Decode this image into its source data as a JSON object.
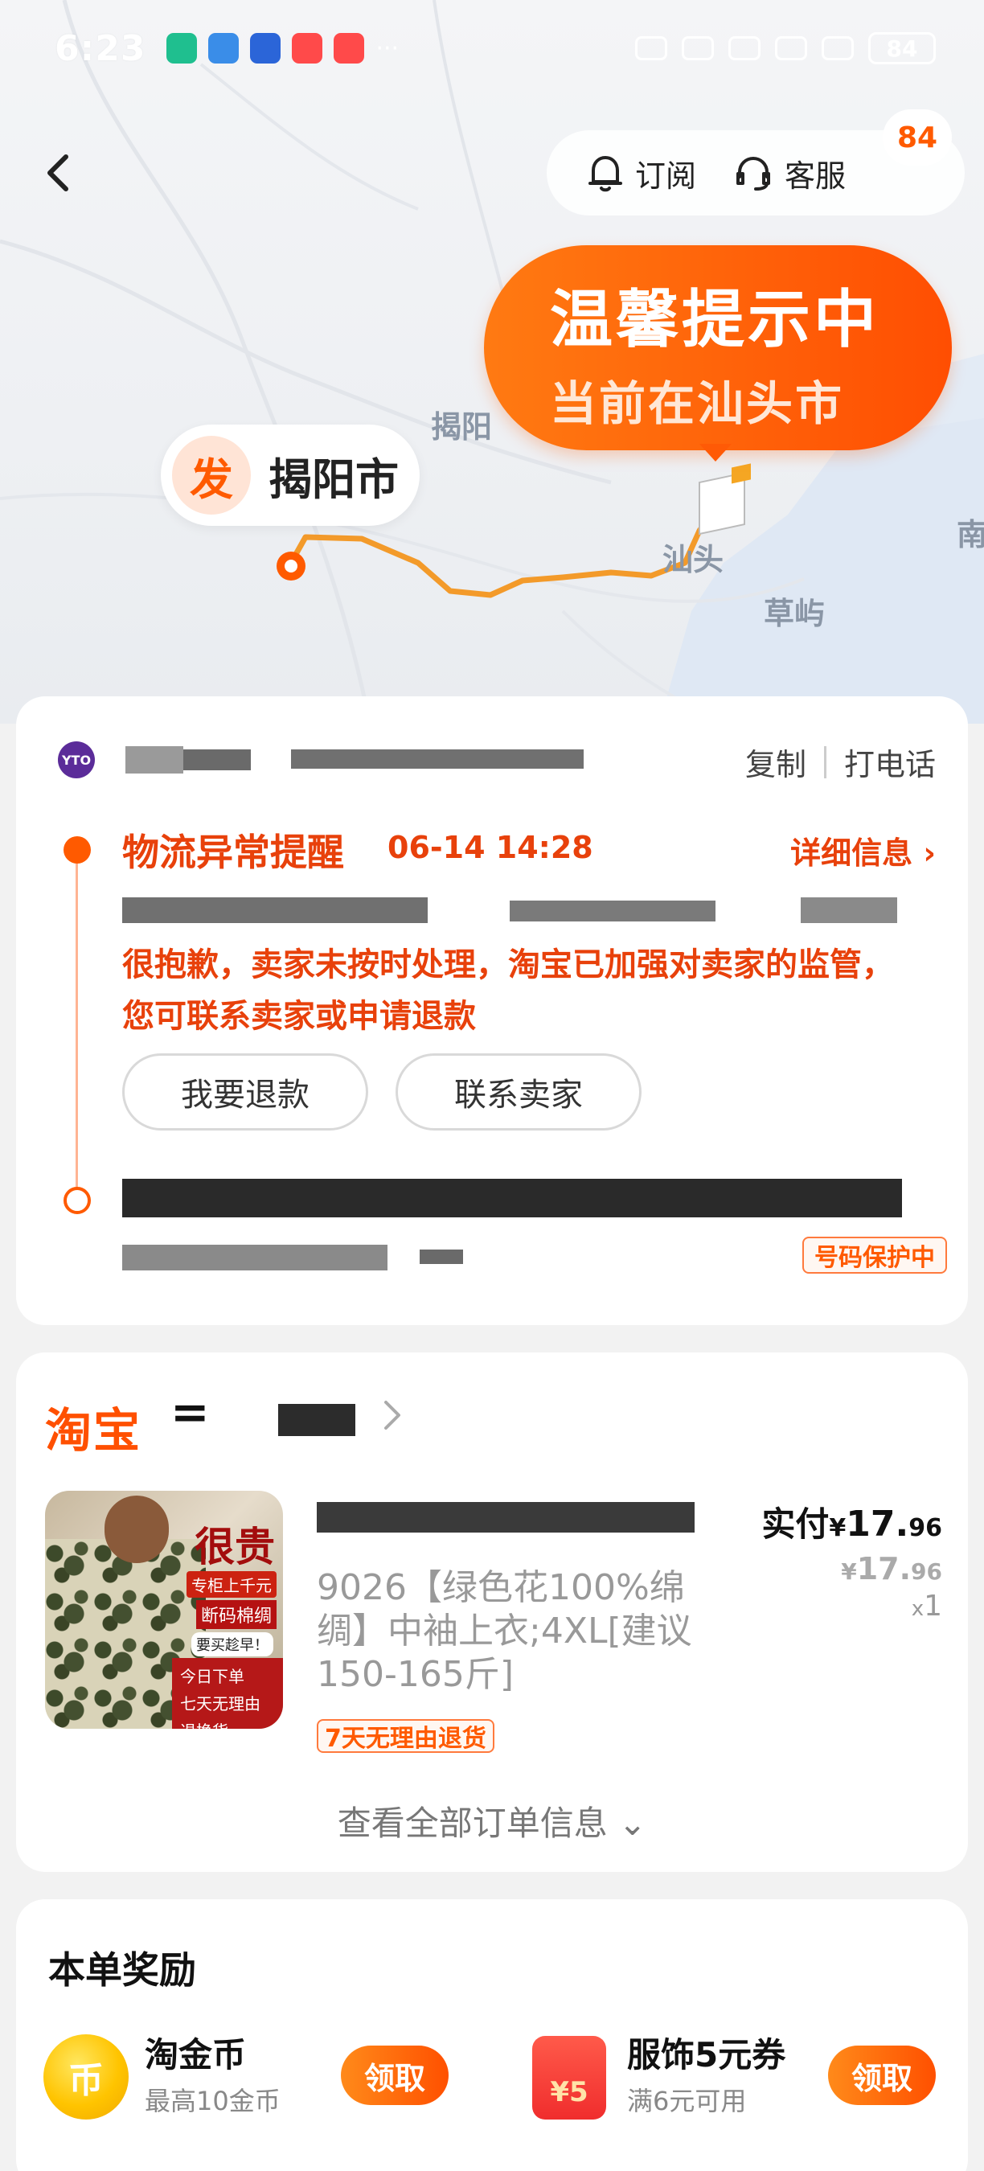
{
  "status_bar": {
    "time": "6:23",
    "battery": "84"
  },
  "top_bar": {
    "subscribe_label": "订阅",
    "service_label": "客服",
    "badge_count": "84"
  },
  "map": {
    "tip_title": "温馨提示中",
    "tip_subtitle": "当前在汕头市",
    "origin_marker": "发",
    "origin_city": "揭阳市",
    "labels": {
      "jieyang": "揭阳",
      "shantou": "汕头",
      "caoyu": "草屿",
      "nan": "南"
    }
  },
  "logistics": {
    "carrier_logo_text": "YTO",
    "copy_label": "复制",
    "call_label": "打电话",
    "exception_title": "物流异常提醒",
    "exception_time": "06-14 14:28",
    "detail_label": "详细信息 ›",
    "exception_message": "很抱歉，卖家未按时处理，淘宝已加强对卖家的监管，您可联系卖家或申请退款",
    "refund_button": "我要退款",
    "contact_button": "联系卖家",
    "number_protection_tag": "号码保护中"
  },
  "order": {
    "platform_logo": "淘宝",
    "shop_prefix": "=",
    "product_image_texts": {
      "headline": "很贵",
      "line1": "专柜上千元",
      "line2": "断码棉绸",
      "line3": "要买趁早！",
      "band1": "今日下单",
      "band2": "七天无理由退换货"
    },
    "product_title": "9026【绿色花100%绵绸】中袖上衣;4XL[建议150-165斤]",
    "paid_label": "实付",
    "paid_currency": "¥",
    "paid_int": "17.",
    "paid_dec": "96",
    "orig_currency": "¥",
    "orig_int": "17.",
    "orig_dec": "96",
    "qty_prefix": "x",
    "qty": "1",
    "return_tag": "7天无理由退货",
    "view_all": "查看全部订单信息 ⌄"
  },
  "rewards": {
    "title": "本单奖励",
    "items": [
      {
        "icon": "coin-icon",
        "icon_text": "币",
        "name": "淘金币",
        "sub": "最高10金币",
        "button": "领取"
      },
      {
        "icon": "coupon-icon",
        "icon_text": "¥5",
        "name": "服饰5元券",
        "sub": "满6元可用",
        "button": "领取"
      }
    ]
  },
  "colors": {
    "accent_orange": "#ff5a00",
    "alert_text": "#e8410b",
    "taobao_orange": "#ff5000"
  }
}
